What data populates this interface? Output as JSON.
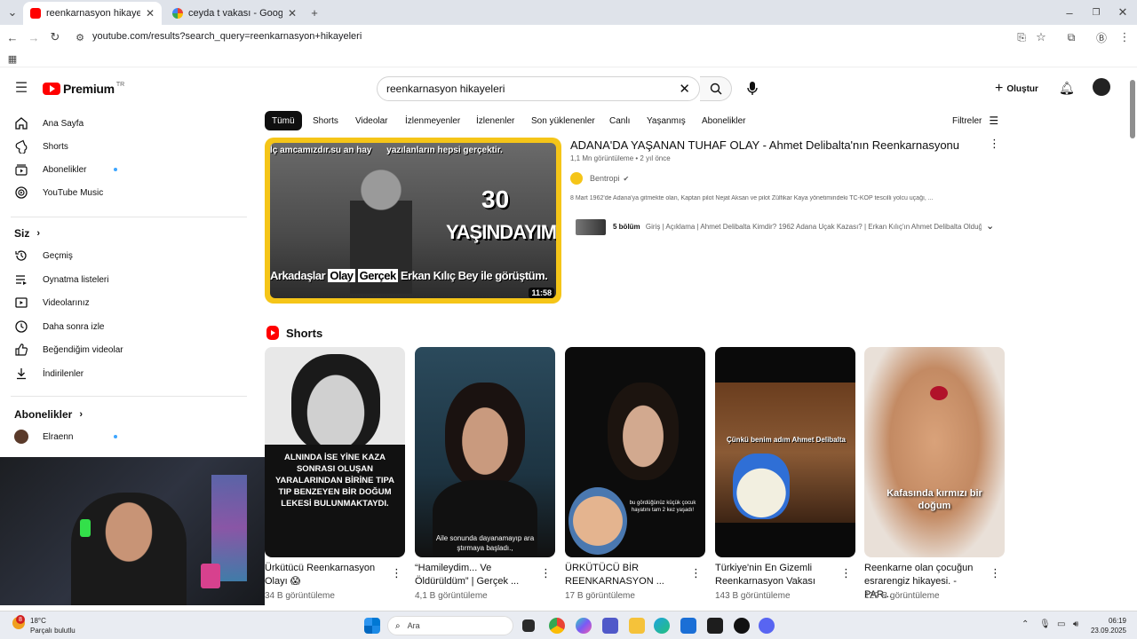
{
  "browser": {
    "tabs": [
      {
        "title": "reenkarnasyon hikayeleri - YouTube",
        "active": true
      },
      {
        "title": "ceyda t vakası - Google'da Ara",
        "active": false
      }
    ],
    "url": "youtube.com/results?search_query=reenkarnasyon+hikayeleri"
  },
  "header": {
    "logo_text": "Premium",
    "logo_country": "TR",
    "search_value": "reenkarnasyon hikayeleri",
    "create_label": "Oluştur"
  },
  "sidebar": {
    "main": [
      {
        "label": "Ana Sayfa",
        "icon": "home-icon"
      },
      {
        "label": "Shorts",
        "icon": "shorts-icon"
      },
      {
        "label": "Abonelikler",
        "icon": "subscriptions-icon",
        "dot": true
      },
      {
        "label": "YouTube Music",
        "icon": "music-icon"
      }
    ],
    "you_header": "Siz",
    "you": [
      {
        "label": "Geçmiş",
        "icon": "history-icon"
      },
      {
        "label": "Oynatma listeleri",
        "icon": "playlist-icon"
      },
      {
        "label": "Videolarınız",
        "icon": "your-videos-icon"
      },
      {
        "label": "Daha sonra izle",
        "icon": "watch-later-icon"
      },
      {
        "label": "Beğendiğim videolar",
        "icon": "liked-icon"
      },
      {
        "label": "İndirilenler",
        "icon": "download-icon"
      }
    ],
    "subs_header": "Abonelikler",
    "subs": [
      {
        "label": "Elraenn",
        "dot": true
      }
    ]
  },
  "chips": [
    "Tümü",
    "Shorts",
    "Videolar",
    "İzlenmeyenler",
    "İzlenenler",
    "Son yüklenenler",
    "Canlı",
    "Yaşanmış",
    "Abonelikler"
  ],
  "filters_label": "Filtreler",
  "video": {
    "title": "ADANA'DA YAŞANAN TUHAF OLAY - Ahmet Delibalta'nın Reenkarnasyonu",
    "views": "1,1 Mn görüntüleme",
    "age": "2 yıl önce",
    "channel": "Bentropi",
    "description": "8 Mart 1962'de Adana'ya gitmekte olan, Kaptan pilot Nejat Aksan ve pilot Zülfikar Kaya yönetimindeki TC-KOP tescilli yolcu uçağı, ...",
    "chapters_count": "5 bölüm",
    "chapters": "Giriş | Açıklama | Ahmet Delibalta Kimdir? 1962 Adana Uçak Kazası? | Erkan Kılıç'ın Ahmet Delibalta Olduğ...",
    "duration": "11:58",
    "thumb_top": "İç amcamızdır.su an hay",
    "thumb_top2": "yazılanların hepsi gerçektir.",
    "thumb_big1": "30",
    "thumb_big2": "YAŞINDAYIM",
    "thumb_bottom_a": "Arkadaşlar",
    "thumb_bottom_b": "Olay",
    "thumb_bottom_c": "Gerçek",
    "thumb_bottom_d": "Erkan Kılıç Bey ile görüştüm."
  },
  "shorts_header": "Shorts",
  "shorts": [
    {
      "title": "Ürkütücü Reenkarnasyon Olayı 😱",
      "views": "34 B görüntüleme",
      "overlay": "ALNINDA İSE YİNE KAZA SONRASI OLUŞAN YARALARINDAN BİRİNE TIPA TIP BENZEYEN BİR DOĞUM LEKESİ BULUNMAKTAYDI."
    },
    {
      "title": "“Hamileydim... Ve Öldürüldüm” | Gerçek ...",
      "views": "4,1 B görüntüleme",
      "overlay": "Aile sonunda dayanamayıp ara ştırmaya başladı.,"
    },
    {
      "title": "ÜRKÜTÜCÜ BİR REENKARNASYON ...",
      "views": "17 B görüntüleme",
      "overlay": "bu gördüğünüz küçük çocuk hayatını tam 2 kez yaşadı!"
    },
    {
      "title": "Türkiye'nin En Gizemli Reenkarnasyon Vakası",
      "views": "143 B görüntüleme",
      "overlay": "Çünkü benim adım Ahmet Delibalta"
    },
    {
      "title": "Reenkarne olan çocuğun esrarengiz hikayesi. - PAR...",
      "views": "129 B görüntüleme",
      "overlay": "Kafasında kırmızı bir doğum"
    }
  ],
  "taskbar": {
    "weather_temp": "18°C",
    "weather_desc": "Parçalı bulutlu",
    "search_placeholder": "Ara",
    "badge": "8",
    "time": "06:19",
    "date": "23.09.2025"
  },
  "colors": {
    "yt_red": "#ff0000",
    "chip_active": "#0f0f0f",
    "thumb_border": "#f5c518"
  }
}
